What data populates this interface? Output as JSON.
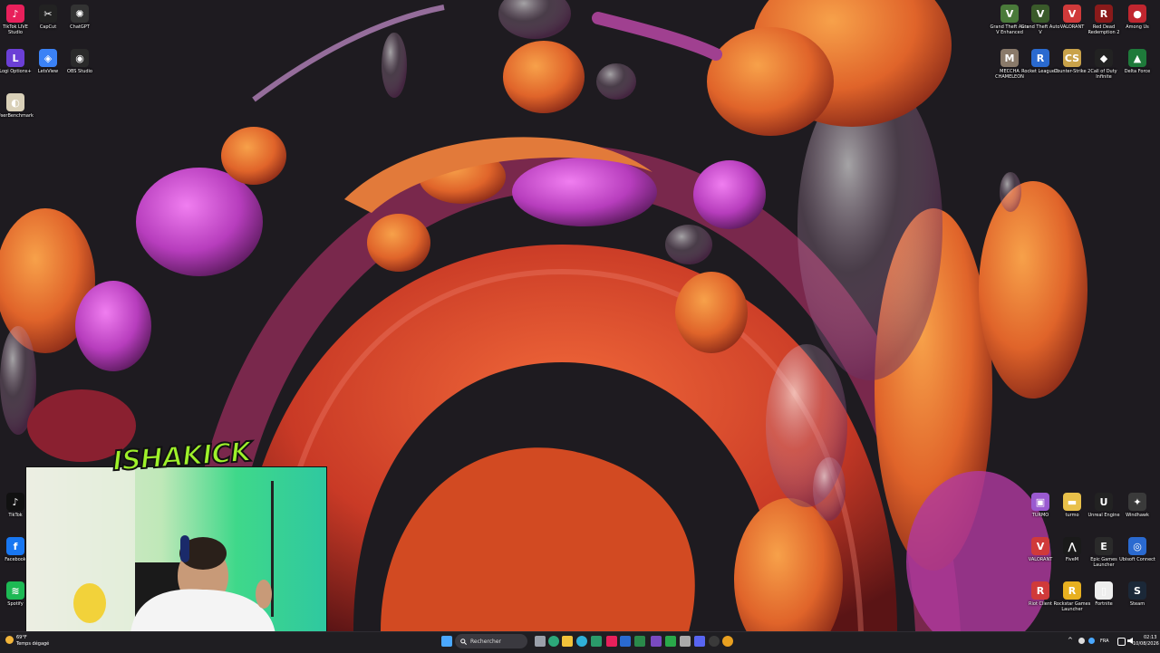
{
  "desktop_left": [
    {
      "label": "TikTok LIVE Studio",
      "icon": "tiktok-live-icon",
      "color": "#e8205b",
      "glyph": "♪"
    },
    {
      "label": "CapCut",
      "icon": "capcut-icon",
      "color": "#222222",
      "glyph": "✂"
    },
    {
      "label": "ChatGPT",
      "icon": "chatgpt-icon",
      "color": "#333333",
      "glyph": "✺"
    },
    {
      "label": "Logi Options+",
      "icon": "logi-options-icon",
      "color": "#6b3fd6",
      "glyph": "L"
    },
    {
      "label": "LetsView",
      "icon": "letsview-icon",
      "color": "#3b82f6",
      "glyph": "◈"
    },
    {
      "label": "OBS Studio",
      "icon": "obs-studio-icon",
      "color": "#2a2a2a",
      "glyph": "◉"
    },
    {
      "label": "UserBenchmark",
      "icon": "userbenchmark-icon",
      "color": "#d9d0b8",
      "glyph": "◐"
    }
  ],
  "desktop_left_bottom": [
    {
      "label": "TikTok",
      "icon": "tiktok-icon",
      "color": "#111111",
      "glyph": "♪"
    },
    {
      "label": "Facebook",
      "icon": "facebook-icon",
      "color": "#1877f2",
      "glyph": "f"
    },
    {
      "label": "Spotify",
      "icon": "spotify-icon",
      "color": "#1db954",
      "glyph": "≋"
    }
  ],
  "desktop_right_top": [
    {
      "label": "Grand Theft Auto V Enhanced",
      "icon": "gta-enhanced-icon",
      "color": "#4a7a3a",
      "glyph": "V"
    },
    {
      "label": "Grand Theft Auto V",
      "icon": "gta-icon",
      "color": "#3a5a2a",
      "glyph": "V"
    },
    {
      "label": "VALORANT",
      "icon": "valorant-icon",
      "color": "#d03a3a",
      "glyph": "V"
    },
    {
      "label": "Red Dead Redemption 2",
      "icon": "rdr2-icon",
      "color": "#8a1a1a",
      "glyph": "R"
    },
    {
      "label": "Among Us",
      "icon": "among-us-icon",
      "color": "#c0262f",
      "glyph": "●"
    },
    {
      "label": "MECCHA CHAMELEON",
      "icon": "meccha-chameleon-icon",
      "color": "#8a7a6a",
      "glyph": "M"
    },
    {
      "label": "Rocket League®",
      "icon": "rocket-league-icon",
      "color": "#2a6ad0",
      "glyph": "R"
    },
    {
      "label": "Counter-Strike 2",
      "icon": "counter-strike-icon",
      "color": "#c9a24a",
      "glyph": "CS"
    },
    {
      "label": "Call of Duty Infinite",
      "icon": "call-of-duty-icon",
      "color": "#222222",
      "glyph": "◆"
    },
    {
      "label": "Delta Force",
      "icon": "delta-force-icon",
      "color": "#1e7a3a",
      "glyph": "▲"
    }
  ],
  "desktop_right_bottom": [
    {
      "label": "TURMO",
      "icon": "turmo-icon",
      "color": "#9a5ad0",
      "glyph": "▣"
    },
    {
      "label": "turmo",
      "icon": "folder-icon",
      "color": "#e8c04a",
      "glyph": "▬"
    },
    {
      "label": "Unreal Engine",
      "icon": "unreal-engine-icon",
      "color": "#222222",
      "glyph": "U"
    },
    {
      "label": "Windhawk",
      "icon": "windhawk-icon",
      "color": "#3a3a3a",
      "glyph": "✦"
    },
    {
      "label": "VALORANT",
      "icon": "valorant-icon",
      "color": "#d03a3a",
      "glyph": "V"
    },
    {
      "label": "FiveM",
      "icon": "fivem-icon",
      "color": "#1a1a1a",
      "glyph": "⋀"
    },
    {
      "label": "Epic Games Launcher",
      "icon": "epic-games-icon",
      "color": "#2a2a2a",
      "glyph": "E"
    },
    {
      "label": "Ubisoft Connect",
      "icon": "ubisoft-connect-icon",
      "color": "#2a6ad0",
      "glyph": "◎"
    },
    {
      "label": "Riot Client",
      "icon": "riot-client-icon",
      "color": "#d03a3a",
      "glyph": "R"
    },
    {
      "label": "Rockstar Games Launcher",
      "icon": "rockstar-launcher-icon",
      "color": "#e8b020",
      "glyph": "R"
    },
    {
      "label": "Fortnite",
      "icon": "fortnite-icon",
      "color": "#eeeeee",
      "glyph": "▯"
    },
    {
      "label": "Steam",
      "icon": "steam-icon",
      "color": "#1b2838",
      "glyph": "S"
    }
  ],
  "overlay": {
    "logo_text": "ISHAKICK"
  },
  "taskbar": {
    "search_placeholder": "Rechercher",
    "weather_temp": "69°F",
    "weather_desc": "Temps dégagé",
    "language": "FRA",
    "time": "02:13",
    "date": "10/08/2026"
  }
}
